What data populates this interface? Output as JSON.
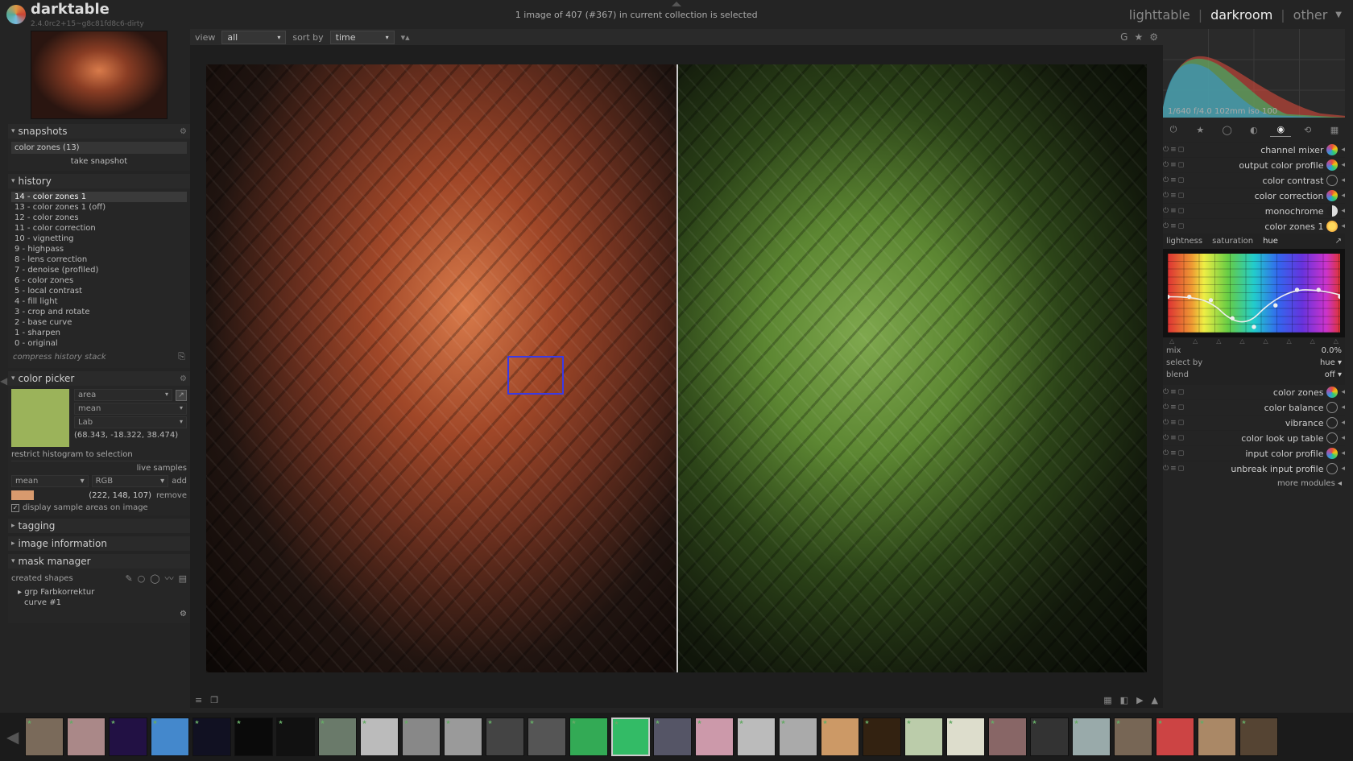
{
  "brand": {
    "name": "darktable",
    "version": "2.4.0rc2+15~g8c81fd8c6-dirty"
  },
  "status_line": "1 image of 407 (#367) in current collection is selected",
  "views": {
    "lighttable": "lighttable",
    "darkroom": "darkroom",
    "other": "other"
  },
  "center_toolbar": {
    "view_label": "view",
    "view_value": "all",
    "sort_label": "sort by",
    "sort_value": "time"
  },
  "snapshots": {
    "title": "snapshots",
    "items": [
      "color zones (13)"
    ],
    "take_label": "take snapshot"
  },
  "history": {
    "title": "history",
    "items": [
      "14 - color zones 1",
      "13 - color zones 1 (off)",
      "12 - color zones",
      "11 - color correction",
      "10 - vignetting",
      "9 - highpass",
      "8 - lens correction",
      "7 - denoise (profiled)",
      "6 - color zones",
      "5 - local contrast",
      "4 - fill light",
      "3 - crop and rotate",
      "2 - base curve",
      "1 - sharpen",
      "0 - original"
    ],
    "selected_index": 0,
    "compress_label": "compress history stack"
  },
  "color_picker": {
    "title": "color picker",
    "mode": "area",
    "stat": "mean",
    "space": "Lab",
    "swatch_color": "#9bb35a",
    "lab_values": "(68.343, -18.322, 38.474)",
    "restrict_label": "restrict histogram to selection",
    "live_label": "live samples",
    "sample_stat": "mean",
    "sample_space": "RGB",
    "add_label": "add",
    "sample_swatch": "#d89a6e",
    "sample_values": "(222, 148, 107)",
    "remove_label": "remove",
    "display_label": "display sample areas on image",
    "display_checked": true
  },
  "tagging": {
    "title": "tagging"
  },
  "image_information": {
    "title": "image information"
  },
  "mask_manager": {
    "title": "mask manager",
    "created_label": "created shapes",
    "items": [
      "grp Farbkorrektur",
      "curve #1"
    ]
  },
  "histogram_caption": "1/640 f/4.0 102mm iso 100",
  "module_tabs": [
    "power",
    "star",
    "circle",
    "half",
    "rgb",
    "swap",
    "grid"
  ],
  "modules": [
    {
      "name": "channel mixer",
      "icon": "rgb"
    },
    {
      "name": "output color profile",
      "icon": "rgb"
    },
    {
      "name": "color contrast",
      "icon": "circle"
    },
    {
      "name": "color correction",
      "icon": "rgb"
    },
    {
      "name": "monochrome",
      "icon": "half"
    },
    {
      "name": "color zones 1",
      "icon": "gold",
      "expanded": true
    },
    {
      "name": "color zones",
      "icon": "rgb"
    },
    {
      "name": "color balance",
      "icon": "circle"
    },
    {
      "name": "vibrance",
      "icon": "circle"
    },
    {
      "name": "color look up table",
      "icon": "circle"
    },
    {
      "name": "input color profile",
      "icon": "rgb"
    },
    {
      "name": "unbreak input profile",
      "icon": "circle"
    }
  ],
  "color_zones": {
    "tabs": [
      "lightness",
      "saturation",
      "hue"
    ],
    "active_tab": 2,
    "mix_label": "mix",
    "mix_value": "0.0%",
    "select_label": "select by",
    "select_value": "hue",
    "blend_label": "blend",
    "blend_value": "off"
  },
  "more_modules_label": "more modules",
  "thumbnails_count": 30
}
